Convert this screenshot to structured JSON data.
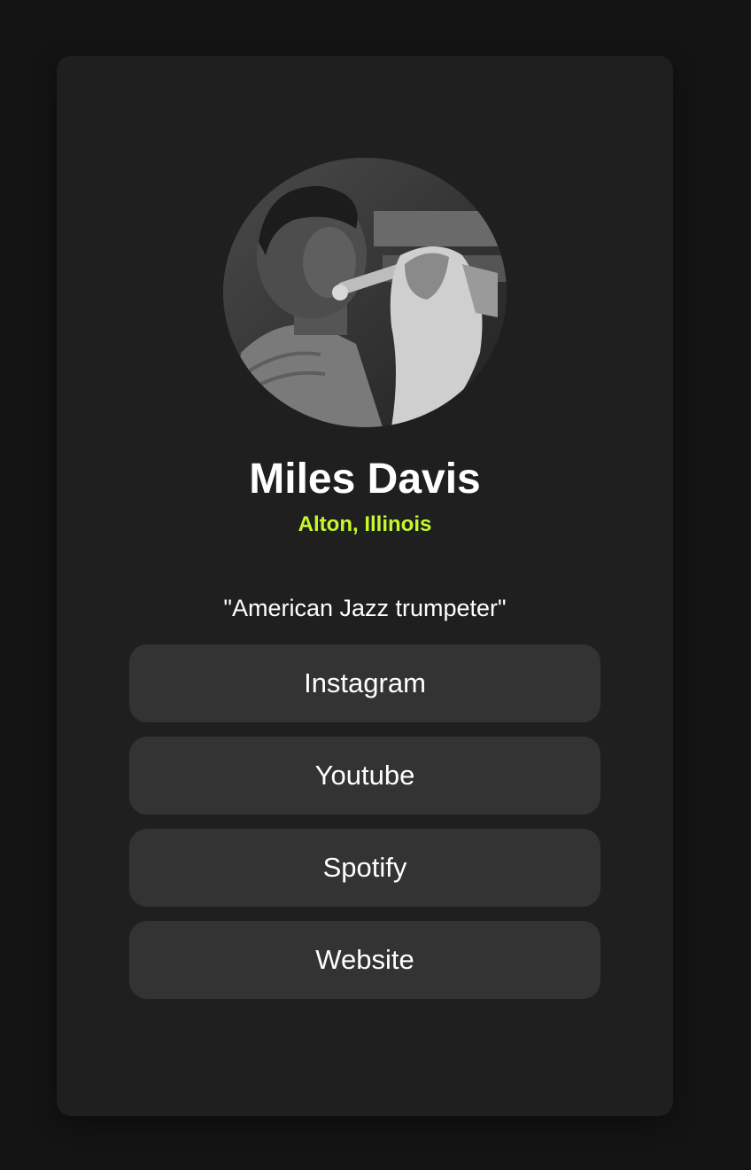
{
  "profile": {
    "name": "Miles Davis",
    "location": "Alton, Illinois",
    "bio": "\"American Jazz trumpeter\""
  },
  "links": {
    "instagram": "Instagram",
    "youtube": "Youtube",
    "spotify": "Spotify",
    "website": "Website"
  },
  "colors": {
    "background": "#141414",
    "card": "#1f1f1f",
    "button": "#333333",
    "accent": "#c5f82a"
  }
}
